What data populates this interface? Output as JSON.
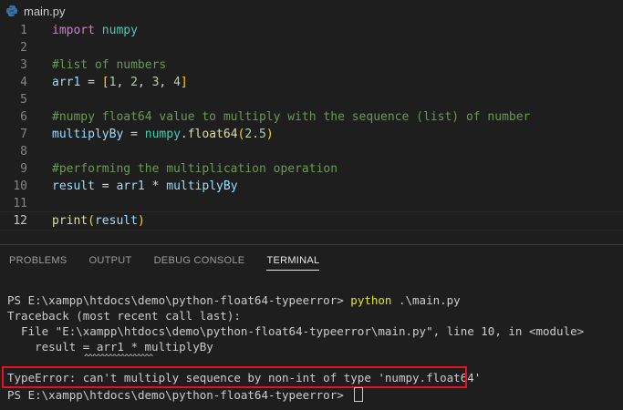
{
  "tab": {
    "filename": "main.py",
    "icon": "python-icon"
  },
  "editor": {
    "lines": [
      {
        "num": "1",
        "text": "import numpy"
      },
      {
        "num": "2",
        "text": ""
      },
      {
        "num": "3",
        "text": "#list of numbers"
      },
      {
        "num": "4",
        "text": "arr1 = [1, 2, 3, 4]"
      },
      {
        "num": "5",
        "text": ""
      },
      {
        "num": "6",
        "text": "#numpy float64 value to multiply with the sequence (list) of number"
      },
      {
        "num": "7",
        "text": "multiplyBy = numpy.float64(2.5)"
      },
      {
        "num": "8",
        "text": ""
      },
      {
        "num": "9",
        "text": "#performing the multiplication operation"
      },
      {
        "num": "10",
        "text": "result = arr1 * multiplyBy"
      },
      {
        "num": "11",
        "text": ""
      },
      {
        "num": "12",
        "text": "print(result)"
      }
    ]
  },
  "panel": {
    "tabs": [
      "PROBLEMS",
      "OUTPUT",
      "DEBUG CONSOLE",
      "TERMINAL"
    ],
    "active_tab": "TERMINAL"
  },
  "terminal": {
    "prompt1": "PS E:\\xampp\\htdocs\\demo\\python-float64-typeerror> ",
    "cmd_python": "python",
    "cmd_arg": " .\\main.py",
    "traceback": "Traceback (most recent call last):",
    "file_line": "  File \"E:\\xampp\\htdocs\\demo\\python-float64-typeerror\\main.py\", line 10, in <module>",
    "code_line": "    result = arr1 * multiplyBy",
    "carets": "^^^^^^^^^^^^^^^^^",
    "error": "TypeError: can't multiply sequence by non-int of type 'numpy.float64'",
    "prompt2": "PS E:\\xampp\\htdocs\\demo\\python-float64-typeerror> "
  },
  "colors": {
    "error_highlight": "#e81123",
    "python_keyword": "#c586c0",
    "comment": "#6a9955"
  }
}
